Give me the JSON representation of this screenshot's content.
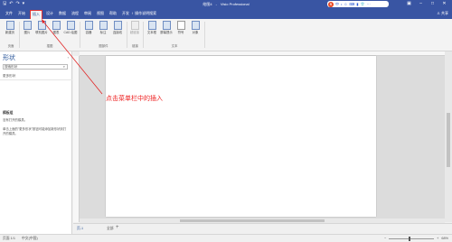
{
  "title_bar": {
    "doc_name": "绘图4",
    "separator": "-",
    "app_name": "Visio Professional",
    "qat": [
      "save-icon",
      "undo-icon",
      "redo-icon",
      "customize-icon"
    ],
    "ime": {
      "logo": "S",
      "items": [
        "中",
        "•",
        "☺",
        "⌨",
        "▮",
        "👕",
        "⋯"
      ]
    },
    "window_controls": [
      "ribbon-options-icon",
      "minimize-icon",
      "maximize-icon",
      "close-icon"
    ]
  },
  "tabs": [
    {
      "label": "文件"
    },
    {
      "label": "开始"
    },
    {
      "label": "插入"
    },
    {
      "label": "设计"
    },
    {
      "label": "数据"
    },
    {
      "label": "流程"
    },
    {
      "label": "审阅"
    },
    {
      "label": "视图"
    },
    {
      "label": "帮助"
    },
    {
      "label": "开发"
    }
  ],
  "active_tab": "插入",
  "tell_me": "♀ 操作说明搜索",
  "share": "♙ 共享",
  "ribbon": {
    "buttons": [
      {
        "label": "新建页"
      },
      {
        "label": "图片"
      },
      {
        "label": "联机图片"
      },
      {
        "label": "图表"
      },
      {
        "label": "CAD 绘图"
      },
      {
        "label": "容器"
      },
      {
        "label": "标注"
      },
      {
        "label": "连接线"
      },
      {
        "label": "超链接"
      },
      {
        "label": "文本框"
      },
      {
        "label": "屏幕提示"
      },
      {
        "label": "符号"
      },
      {
        "label": "对象"
      }
    ],
    "groups": [
      "页面",
      "插图",
      "图部件",
      "链接",
      "文本"
    ]
  },
  "shapes_panel": {
    "title": "形状",
    "search_value": "搜索形状",
    "more_shapes": "更多形状",
    "stencil_title": "模板组",
    "stencil_empty": "没有打开的模具。",
    "stencil_hint": "单击上面的\"更多形状\"按钮可能添加新形状到打开的模具。"
  },
  "page_tabs": {
    "page": "页-1",
    "all": "全部",
    "add": "+"
  },
  "status_bar": {
    "page": "页面 1/1",
    "language": "中文(中国)",
    "zoom": "68%"
  },
  "annotation": {
    "text": "点击菜单栏中的插入",
    "color": "#e22222"
  }
}
